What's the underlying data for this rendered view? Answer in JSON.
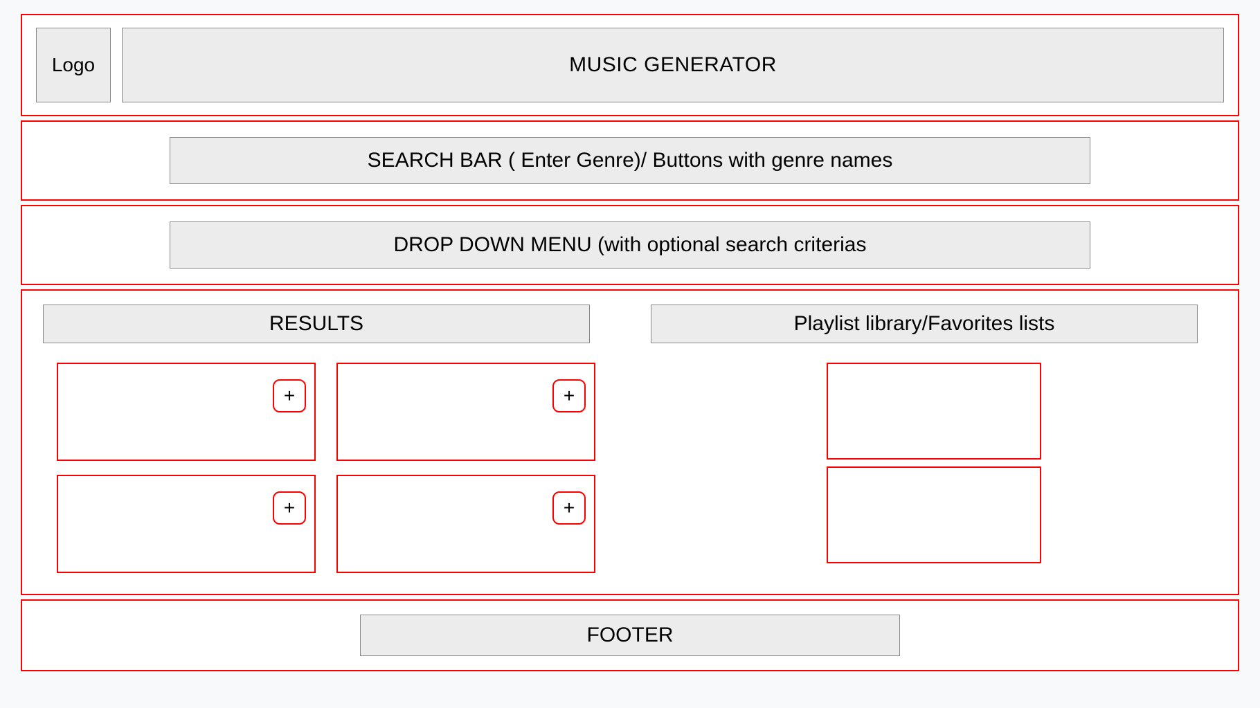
{
  "header": {
    "logo_label": "Logo",
    "title": "MUSIC GENERATOR"
  },
  "search": {
    "label": "SEARCH BAR ( Enter Genre)/ Buttons with genre names"
  },
  "dropdown": {
    "label": "DROP DOWN MENU (with optional search criterias"
  },
  "results": {
    "header": "RESULTS",
    "plus_label": "+",
    "cards": [
      "",
      "",
      "",
      ""
    ]
  },
  "playlist": {
    "header": "Playlist library/Favorites lists",
    "items": [
      "",
      ""
    ]
  },
  "footer": {
    "label": "FOOTER"
  }
}
